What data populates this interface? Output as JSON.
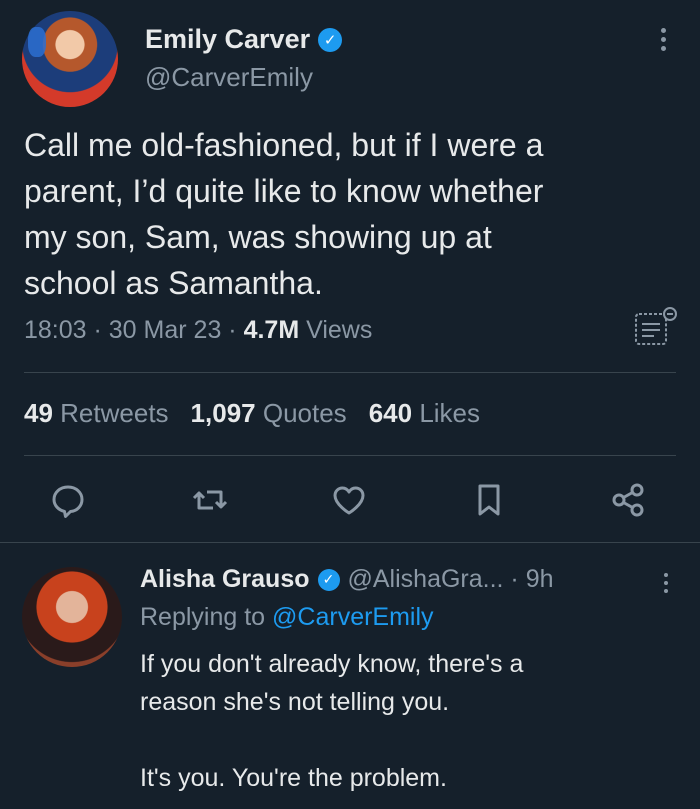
{
  "tweet": {
    "author_name": "Emily Carver",
    "author_handle": "@CarverEmily",
    "text_lines": [
      "Call me old-fashioned, but if I were a",
      "parent, I’d quite like to know whether",
      "my son, Sam, was showing up at",
      "school as Samantha."
    ],
    "time": "18:03",
    "date": "30 Mar 23",
    "views_count": "4.7M",
    "views_label": "Views",
    "stats": {
      "retweets_count": "49",
      "retweets_label": "Retweets",
      "quotes_count": "1,097",
      "quotes_label": "Quotes",
      "likes_count": "640",
      "likes_label": "Likes"
    },
    "actions": [
      "reply-icon",
      "retweet-icon",
      "like-icon",
      "bookmark-icon",
      "share-icon"
    ]
  },
  "reply": {
    "author_name": "Alisha Grauso",
    "author_handle": "@AlishaGra...",
    "time": "9h",
    "replying_prefix": "Replying to",
    "replying_to": "@CarverEmily",
    "text_lines": [
      "If you don't already know, there's a",
      "reason she's not telling you."
    ],
    "text_last": "It's you. You're the problem."
  },
  "colors": {
    "background": "#15202b",
    "text": "#e7e9ea",
    "muted": "#8b98a5",
    "accent": "#1d9bf0",
    "divider": "#38444d"
  }
}
